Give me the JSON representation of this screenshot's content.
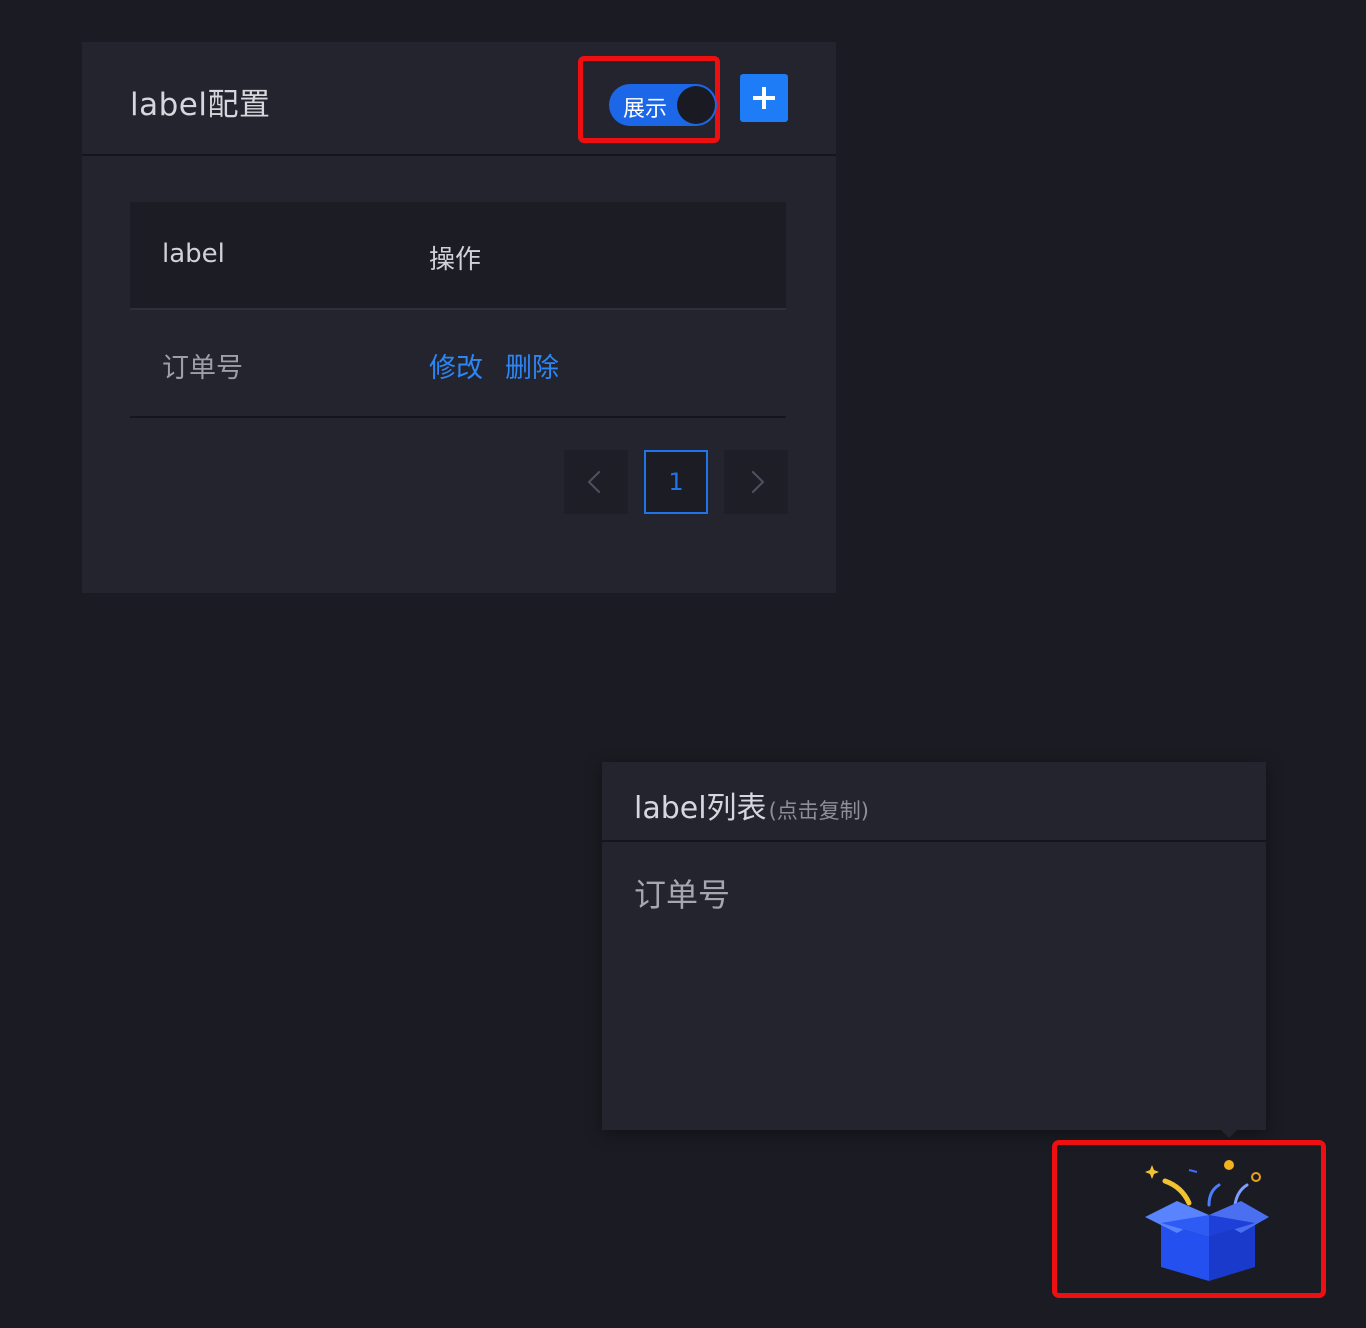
{
  "panel": {
    "title": "label配置",
    "toggle_label": "展示",
    "add_button_icon": "plus-icon"
  },
  "table": {
    "headers": [
      "label",
      "操作"
    ],
    "rows": [
      {
        "label": "订单号",
        "actions": [
          "修改",
          "删除"
        ]
      }
    ]
  },
  "pagination": {
    "current_page": "1",
    "prev_icon": "chevron-left-icon",
    "next_icon": "chevron-right-icon"
  },
  "popup": {
    "title": "label列表",
    "hint": "(点击复制)",
    "items": [
      "订单号"
    ]
  },
  "colors": {
    "background": "#1b1c23",
    "panel": "#23242e",
    "accent": "#1e7cf6",
    "link": "#2c86f5",
    "highlight": "#ee1010"
  },
  "gift": {
    "icon": "gift-box-icon"
  }
}
